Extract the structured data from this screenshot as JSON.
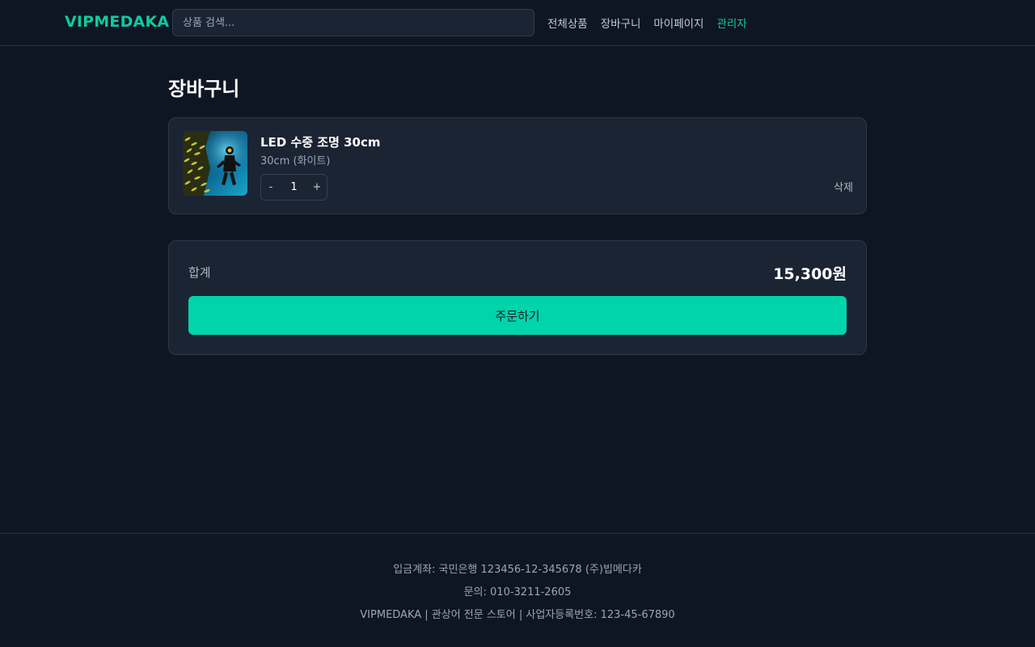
{
  "header": {
    "logo": "VIPMEDAKA",
    "search_placeholder": "상품 검색...",
    "nav": [
      "전체상품",
      "장바구니",
      "마이페이지",
      "관리자"
    ]
  },
  "page": {
    "title": "장바구니"
  },
  "cart": {
    "items": [
      {
        "name": "LED 수중 조명 30cm",
        "option": "30cm (화이트)",
        "quantity": "1",
        "decrement": "-",
        "increment": "+",
        "delete_label": "삭제"
      }
    ]
  },
  "summary": {
    "label": "합계",
    "total": "15,300원",
    "order_button": "주문하기"
  },
  "footer": {
    "account": "입금계좌: 국민은행 123456-12-345678 (주)빕메다카",
    "contact": "문의: 010-3211-2605",
    "info": "VIPMEDAKA | 관상어 전문 스토어 | 사업자등록번호: 123-45-67890"
  },
  "colors": {
    "background": "#0f1623",
    "panel": "#1b2433",
    "accent": "#00d4aa",
    "brand": "#10c9a0"
  }
}
